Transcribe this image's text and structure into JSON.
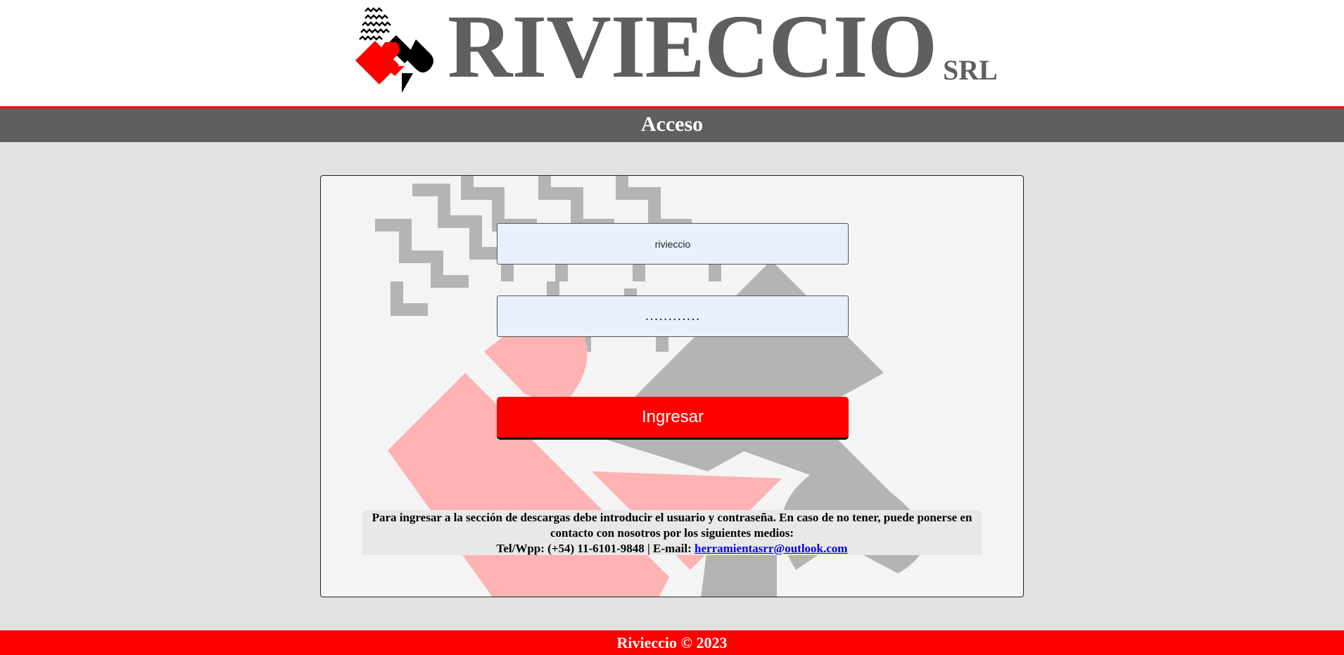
{
  "header": {
    "brand_name": "RIVIECCIO",
    "brand_suffix": "SRL",
    "logo_colors": {
      "red": "#ff0000",
      "black": "#000000"
    }
  },
  "title_bar": {
    "title": "Acceso"
  },
  "login": {
    "username_value": "rivieccio",
    "password_value": "............",
    "submit_label": "Ingresar"
  },
  "info": {
    "message": "Para ingresar a la sección de descargas debe introducir el usuario y contraseña. En caso de no tener, puede ponerse en contacto con nosotros por los siguientes medios:",
    "contact_prefix": "Tel/Wpp: (+54) 11-6101-9848 | E-mail: ",
    "email": "herramientasrr@outlook.com"
  },
  "footer": {
    "text": "Rivieccio © 2023"
  },
  "colors": {
    "accent_red": "#ff0000",
    "dark_gray": "#5f5f5f",
    "page_bg": "#e2e2e2",
    "panel_bg": "#f4f4f4",
    "input_bg": "#e8f0fe"
  }
}
